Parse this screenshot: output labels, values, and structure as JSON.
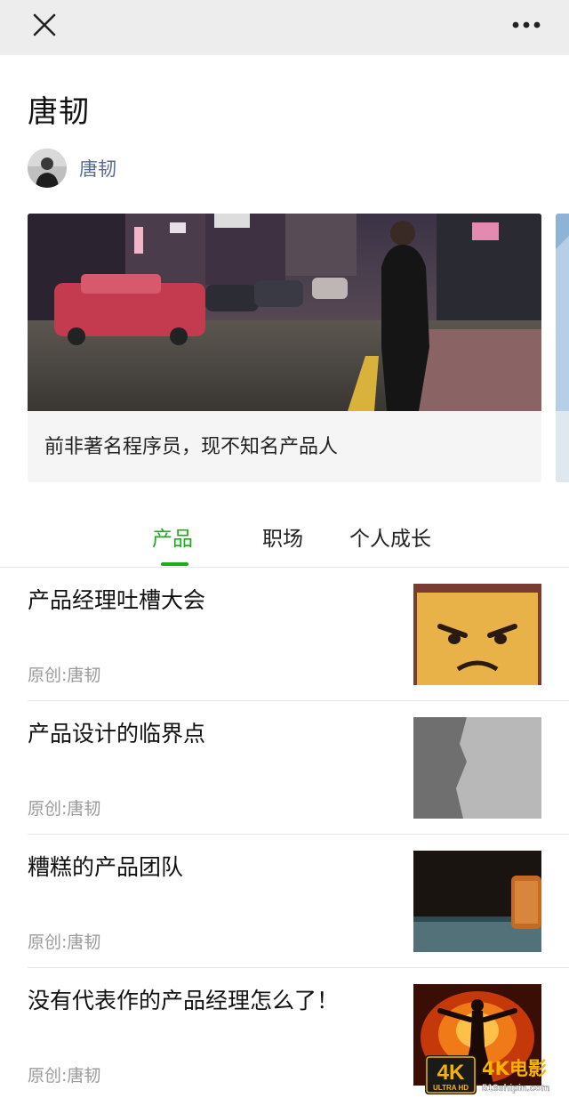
{
  "topbar": {
    "close_icon": "close-icon",
    "more_icon": "more-horizontal-icon"
  },
  "article": {
    "title": "唐韧"
  },
  "author": {
    "name": "唐韧",
    "avatar_icon": "avatar"
  },
  "profile_card": {
    "caption": "前非著名程序员，现不知名产品人"
  },
  "tabs": [
    {
      "label": "产品",
      "active": true
    },
    {
      "label": "职场",
      "active": false
    },
    {
      "label": "个人成长",
      "active": false
    }
  ],
  "articles": [
    {
      "title": "产品经理吐槽大会",
      "meta": "原创:唐韧"
    },
    {
      "title": "产品设计的临界点",
      "meta": "原创:唐韧"
    },
    {
      "title": "糟糕的产品团队",
      "meta": "原创:唐韧"
    },
    {
      "title": "没有代表作的产品经理怎么了！",
      "meta": "原创:唐韧"
    }
  ],
  "watermark": {
    "badge_top": "4K",
    "badge_bottom": "ULTRA HD",
    "brand": "4K电影",
    "site": "518shipin.com"
  },
  "colors": {
    "accent": "#1aad19",
    "link": "#576b95",
    "topbar": "#ededed"
  }
}
